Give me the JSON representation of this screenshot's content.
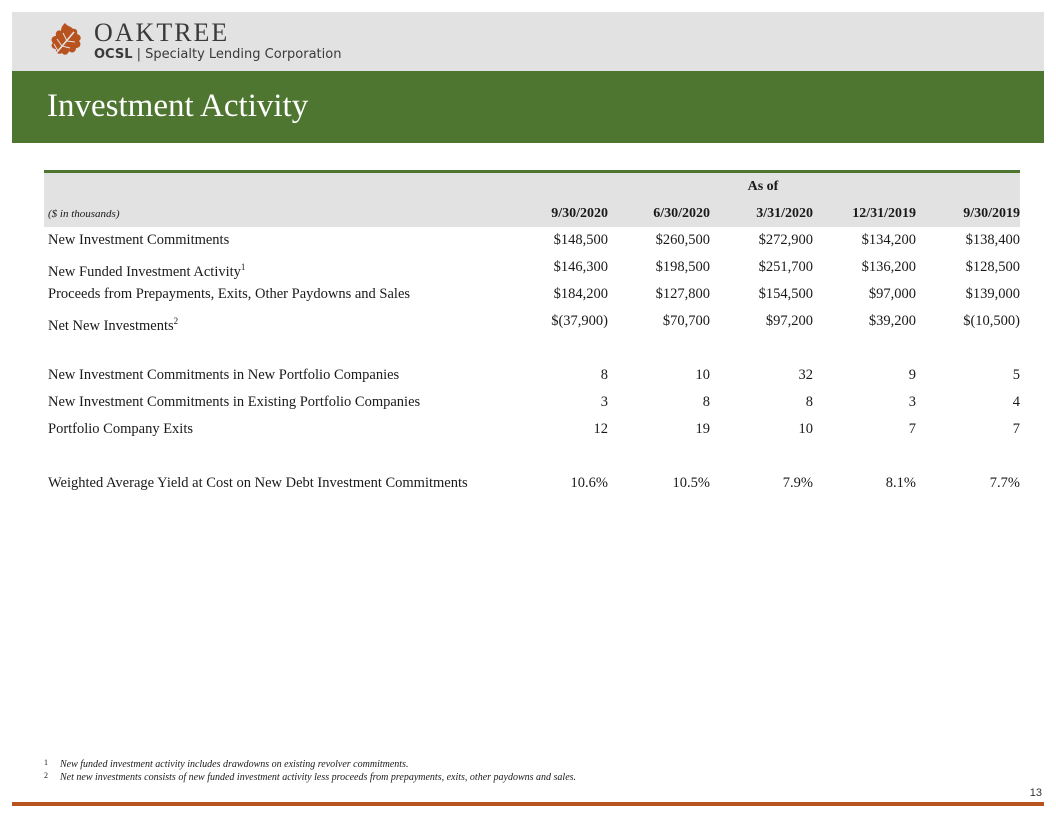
{
  "brand": {
    "name": "OAKTREE",
    "ticker": "OCSL",
    "separator": "|",
    "company": "Specialty Lending Corporation",
    "colors": {
      "green": "#4e7630",
      "leaf": "#b8521f",
      "header_gray": "#e2e2e2"
    }
  },
  "page": {
    "title": "Investment Activity",
    "number": "13"
  },
  "table": {
    "group_header": "As of",
    "units_label": "($ in thousands)",
    "columns": [
      "9/30/2020",
      "6/30/2020",
      "3/31/2020",
      "12/31/2019",
      "9/30/2019"
    ],
    "rows": [
      {
        "label": "New Investment Commitments",
        "sup": "",
        "values": [
          "$148,500",
          "$260,500",
          "$272,900",
          "$134,200",
          "$138,400"
        ]
      },
      {
        "label": "New Funded Investment Activity",
        "sup": "1",
        "values": [
          "$146,300",
          "$198,500",
          "$251,700",
          "$136,200",
          "$128,500"
        ]
      },
      {
        "label": "Proceeds from Prepayments, Exits, Other Paydowns and Sales",
        "sup": "",
        "values": [
          "$184,200",
          "$127,800",
          "$154,500",
          "$97,000",
          "$139,000"
        ]
      },
      {
        "label": "Net New Investments",
        "sup": "2",
        "values": [
          "$(37,900)",
          "$70,700",
          "$97,200",
          "$39,200",
          "$(10,500)"
        ]
      },
      {
        "label": "New Investment Commitments in New Portfolio Companies",
        "sup": "",
        "values": [
          "8",
          "10",
          "32",
          "9",
          "5"
        ]
      },
      {
        "label": "New Investment Commitments in Existing Portfolio Companies",
        "sup": "",
        "values": [
          "3",
          "8",
          "8",
          "3",
          "4"
        ]
      },
      {
        "label": "Portfolio Company Exits",
        "sup": "",
        "values": [
          "12",
          "19",
          "10",
          "7",
          "7"
        ]
      },
      {
        "label": "Weighted Average Yield at Cost on New Debt Investment Commitments",
        "sup": "",
        "values": [
          "10.6%",
          "10.5%",
          "7.9%",
          "8.1%",
          "7.7%"
        ]
      }
    ]
  },
  "footnotes": [
    {
      "marker": "1",
      "text": "New funded investment activity includes drawdowns on existing revolver commitments."
    },
    {
      "marker": "2",
      "text": "Net new investments consists of new funded investment activity less proceeds from prepayments, exits, other paydowns and sales."
    }
  ]
}
